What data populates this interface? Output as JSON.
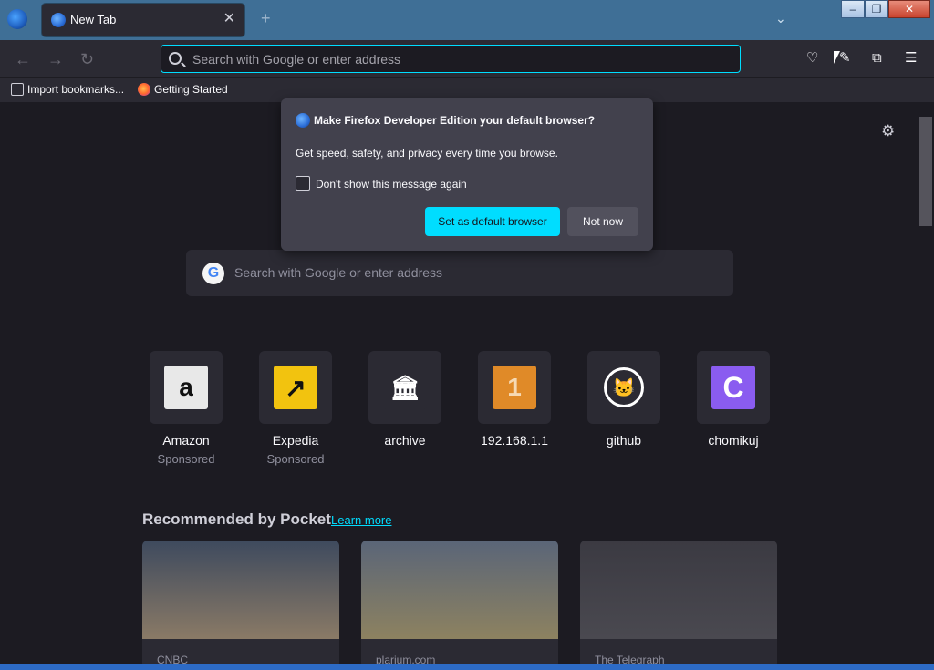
{
  "browser": {
    "tab_title": "New Tab",
    "tab_close": "✕",
    "new_tab": "+",
    "window_controls": {
      "minimize": "–",
      "restore": "❐",
      "close": "✕"
    }
  },
  "navbar": {
    "back": "←",
    "forward": "→",
    "reload": "↻",
    "url_placeholder": "Search with Google or enter address"
  },
  "bookmarks": [
    {
      "label": "Import bookmarks..."
    },
    {
      "label": "Getting Started"
    }
  ],
  "popup": {
    "title": "Make Firefox Developer Edition your default browser?",
    "description": "Get speed, safety, and privacy every time you browse.",
    "checkbox_label": "Don't show this message again",
    "primary_button": "Set as default browser",
    "secondary_button": "Not now"
  },
  "ntp_search": {
    "placeholder": "Search with Google or enter address"
  },
  "top_sites": [
    {
      "label": "Amazon",
      "sponsor": "Sponsored",
      "icon": "amazon-icon"
    },
    {
      "label": "Expedia",
      "sponsor": "Sponsored",
      "icon": "expedia-icon"
    },
    {
      "label": "archive",
      "sponsor": "",
      "icon": "archive-icon"
    },
    {
      "label": "192.168.1.1",
      "sponsor": "",
      "icon": "router-icon"
    },
    {
      "label": "github",
      "sponsor": "",
      "icon": "github-icon"
    },
    {
      "label": "chomikuj",
      "sponsor": "",
      "icon": "chomikuj-icon"
    }
  ],
  "pocket": {
    "title": "Recommended by Pocket",
    "learn_more": "Learn more",
    "cards": [
      {
        "source": "CNBC"
      },
      {
        "source": "plarium.com"
      },
      {
        "source": "The Telegraph"
      }
    ]
  },
  "colors": {
    "accent": "#00ddff",
    "background": "#1c1b22",
    "surface": "#2b2a33",
    "popup": "#42414d"
  }
}
